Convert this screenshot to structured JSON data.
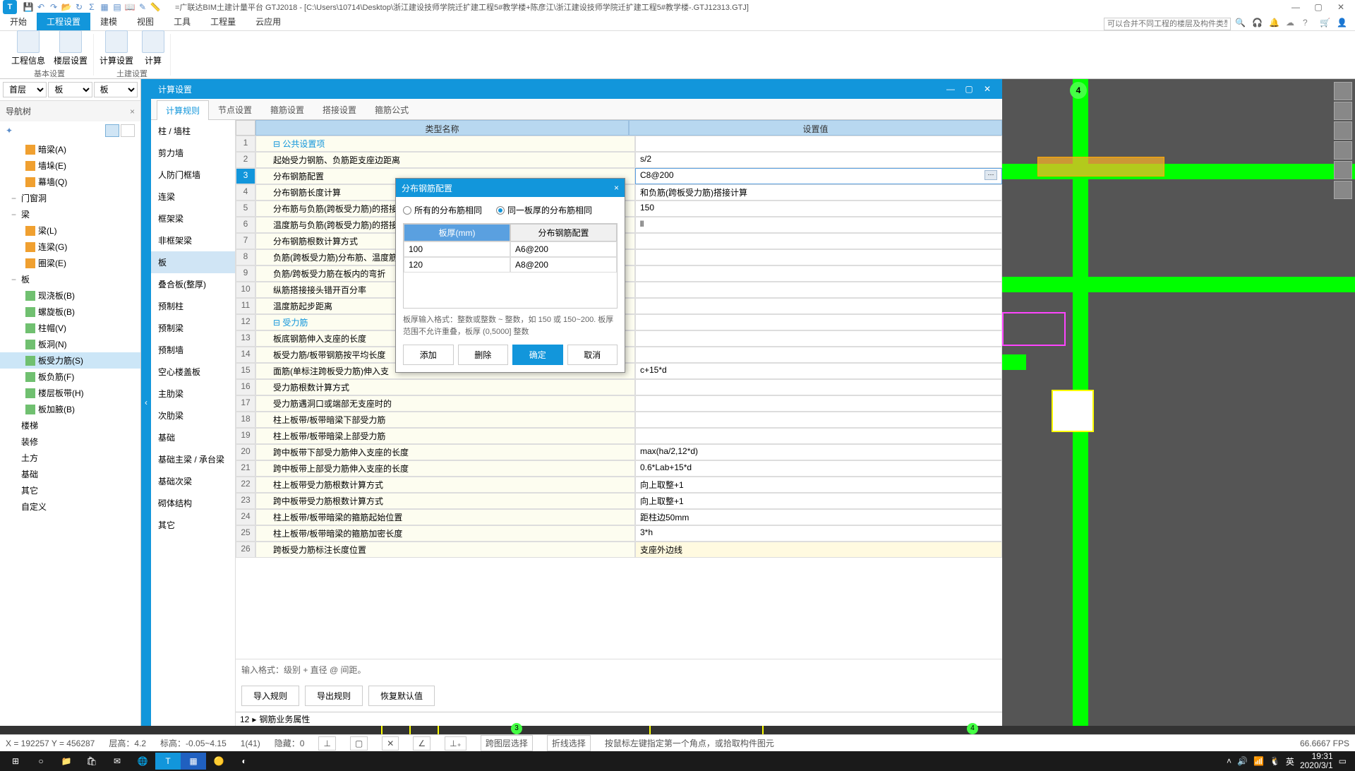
{
  "title": "=广联达BIM土建计量平台 GTJ2018 - [C:\\Users\\10714\\Desktop\\浙江建设技师学院迁扩建工程5#教学楼+陈彦江\\浙江建设技师学院迁扩建工程5#教学楼-.GTJ12313.GTJ]",
  "app_letter": "T",
  "ribbon": {
    "tabs": [
      "开始",
      "工程设置",
      "建模",
      "视图",
      "工具",
      "工程量",
      "云应用"
    ],
    "search_placeholder": "可以合并不同工程的楼层及构件类型吗?",
    "groups": [
      {
        "label": "基本设置",
        "items": [
          "工程信息",
          "楼层设置"
        ]
      },
      {
        "label": "土建设置",
        "items": [
          "计算设置",
          "计算"
        ]
      }
    ]
  },
  "floor": {
    "sel1": "首层",
    "sel2": "板",
    "sel3": "板"
  },
  "nav": {
    "title": "导航树",
    "items": [
      {
        "l": 2,
        "icon": "beam",
        "label": "暗梁(A)"
      },
      {
        "l": 2,
        "icon": "beam",
        "label": "墙垛(E)"
      },
      {
        "l": 2,
        "icon": "beam",
        "label": "幕墙(Q)"
      },
      {
        "l": 1,
        "label": "门窗洞",
        "exp": "−"
      },
      {
        "l": 1,
        "label": "梁",
        "exp": "−"
      },
      {
        "l": 2,
        "icon": "beam",
        "label": "梁(L)"
      },
      {
        "l": 2,
        "icon": "beam",
        "label": "连梁(G)"
      },
      {
        "l": 2,
        "icon": "beam",
        "label": "圈梁(E)"
      },
      {
        "l": 1,
        "label": "板",
        "exp": "−"
      },
      {
        "l": 2,
        "icon": "slab",
        "label": "现浇板(B)"
      },
      {
        "l": 2,
        "icon": "slab",
        "label": "螺旋板(B)"
      },
      {
        "l": 2,
        "icon": "slab",
        "label": "柱帽(V)"
      },
      {
        "l": 2,
        "icon": "slab",
        "label": "板洞(N)"
      },
      {
        "l": 2,
        "icon": "slab",
        "label": "板受力筋(S)",
        "sel": true
      },
      {
        "l": 2,
        "icon": "slab",
        "label": "板负筋(F)"
      },
      {
        "l": 2,
        "icon": "slab",
        "label": "楼层板带(H)"
      },
      {
        "l": 2,
        "icon": "slab",
        "label": "板加腋(B)"
      },
      {
        "l": 1,
        "label": "楼梯"
      },
      {
        "l": 1,
        "label": "装修"
      },
      {
        "l": 1,
        "label": "土方"
      },
      {
        "l": 1,
        "label": "基础"
      },
      {
        "l": 1,
        "label": "其它"
      },
      {
        "l": 1,
        "label": "自定义"
      }
    ]
  },
  "panel": {
    "title": "计算设置",
    "tabs": [
      "计算规则",
      "节点设置",
      "箍筋设置",
      "搭接设置",
      "箍筋公式"
    ],
    "categories": [
      "柱 / 墙柱",
      "剪力墙",
      "人防门框墙",
      "连梁",
      "框架梁",
      "非框架梁",
      "板",
      "叠合板(整厚)",
      "预制柱",
      "预制梁",
      "预制墙",
      "空心楼盖板",
      "主肋梁",
      "次肋梁",
      "基础",
      "基础主梁 / 承台梁",
      "基础次梁",
      "砌体结构",
      "其它"
    ],
    "headers": {
      "name": "类型名称",
      "val": "设置值"
    },
    "rules": [
      {
        "n": "1",
        "group": true,
        "name": "公共设置项"
      },
      {
        "n": "2",
        "name": "起始受力钢筋、负筋距支座边距离",
        "val": "s/2"
      },
      {
        "n": "3",
        "name": "分布钢筋配置",
        "val": "C8@200",
        "sel": true,
        "edit": true
      },
      {
        "n": "4",
        "name": "分布钢筋长度计算",
        "val": "和负筋(跨板受力筋)搭接计算"
      },
      {
        "n": "5",
        "name": "分布筋与负筋(跨板受力筋)的搭接长度",
        "val": "150"
      },
      {
        "n": "6",
        "name": "温度筋与负筋(跨板受力筋)的搭接长度",
        "val": "ll"
      },
      {
        "n": "7",
        "name": "分布钢筋根数计算方式",
        "val": ""
      },
      {
        "n": "8",
        "name": "负筋(跨板受力筋)分布筋、温度筋",
        "val": ""
      },
      {
        "n": "9",
        "name": "负筋/跨板受力筋在板内的弯折",
        "val": ""
      },
      {
        "n": "10",
        "name": "纵筋搭接接头错开百分率",
        "val": ""
      },
      {
        "n": "11",
        "name": "温度筋起步距离",
        "val": ""
      },
      {
        "n": "12",
        "group": true,
        "name": "受力筋"
      },
      {
        "n": "13",
        "name": "板底钢筋伸入支座的长度",
        "val": ""
      },
      {
        "n": "14",
        "name": "板受力筋/板带钢筋按平均长度",
        "val": ""
      },
      {
        "n": "15",
        "name": "面筋(单标注跨板受力筋)伸入支",
        "val": "c+15*d"
      },
      {
        "n": "16",
        "name": "受力筋根数计算方式",
        "val": ""
      },
      {
        "n": "17",
        "name": "受力筋遇洞口或端部无支座时的",
        "val": ""
      },
      {
        "n": "18",
        "name": "柱上板带/板带暗梁下部受力筋",
        "val": ""
      },
      {
        "n": "19",
        "name": "柱上板带/板带暗梁上部受力筋",
        "val": ""
      },
      {
        "n": "20",
        "name": "跨中板带下部受力筋伸入支座的长度",
        "val": "max(ha/2,12*d)"
      },
      {
        "n": "21",
        "name": "跨中板带上部受力筋伸入支座的长度",
        "val": "0.6*Lab+15*d"
      },
      {
        "n": "22",
        "name": "柱上板带受力筋根数计算方式",
        "val": "向上取整+1"
      },
      {
        "n": "23",
        "name": "跨中板带受力筋根数计算方式",
        "val": "向上取整+1"
      },
      {
        "n": "24",
        "name": "柱上板带/板带暗梁的箍筋起始位置",
        "val": "距柱边50mm"
      },
      {
        "n": "25",
        "name": "柱上板带/板带暗梁的箍筋加密长度",
        "val": "3*h"
      },
      {
        "n": "26",
        "name": "跨板受力筋标注长度位置",
        "val": "支座外边线",
        "hl": true
      }
    ],
    "input_hint": "输入格式：级别 + 直径 @ 间距。",
    "buttons": [
      "导入规则",
      "导出规则",
      "恢复默认值"
    ],
    "attr_label": "钢筋业务属性",
    "attr_num": "12"
  },
  "dialog": {
    "title": "分布钢筋配置",
    "radio1": "所有的分布筋相同",
    "radio2": "同一板厚的分布筋相同",
    "th1": "板厚(mm)",
    "th2": "分布钢筋配置",
    "rows": [
      {
        "a": "100",
        "b": "A6@200"
      },
      {
        "a": "120",
        "b": "A8@200"
      }
    ],
    "hint": "板厚输入格式：整数或整数 ~ 整数，如 150 或 150~200.\n板厚范围不允许重叠，板厚 (0,5000] 整数",
    "btns": [
      "添加",
      "删除",
      "确定",
      "取消"
    ]
  },
  "status": {
    "coord": "X = 192257 Y = 456287",
    "floor_h": "层高：4.2",
    "elev": "标高：-0.05~4.15",
    "count": "1(41)",
    "hidden": "隐藏：0",
    "cross": "跨图层选择",
    "ortho": "折线选择",
    "tip": "按鼠标左键指定第一个角点，或拾取构件图元",
    "fps": "66.6667 FPS"
  },
  "taskbar": {
    "ime": "英",
    "time": "19:31",
    "date": "2020/3/1"
  }
}
